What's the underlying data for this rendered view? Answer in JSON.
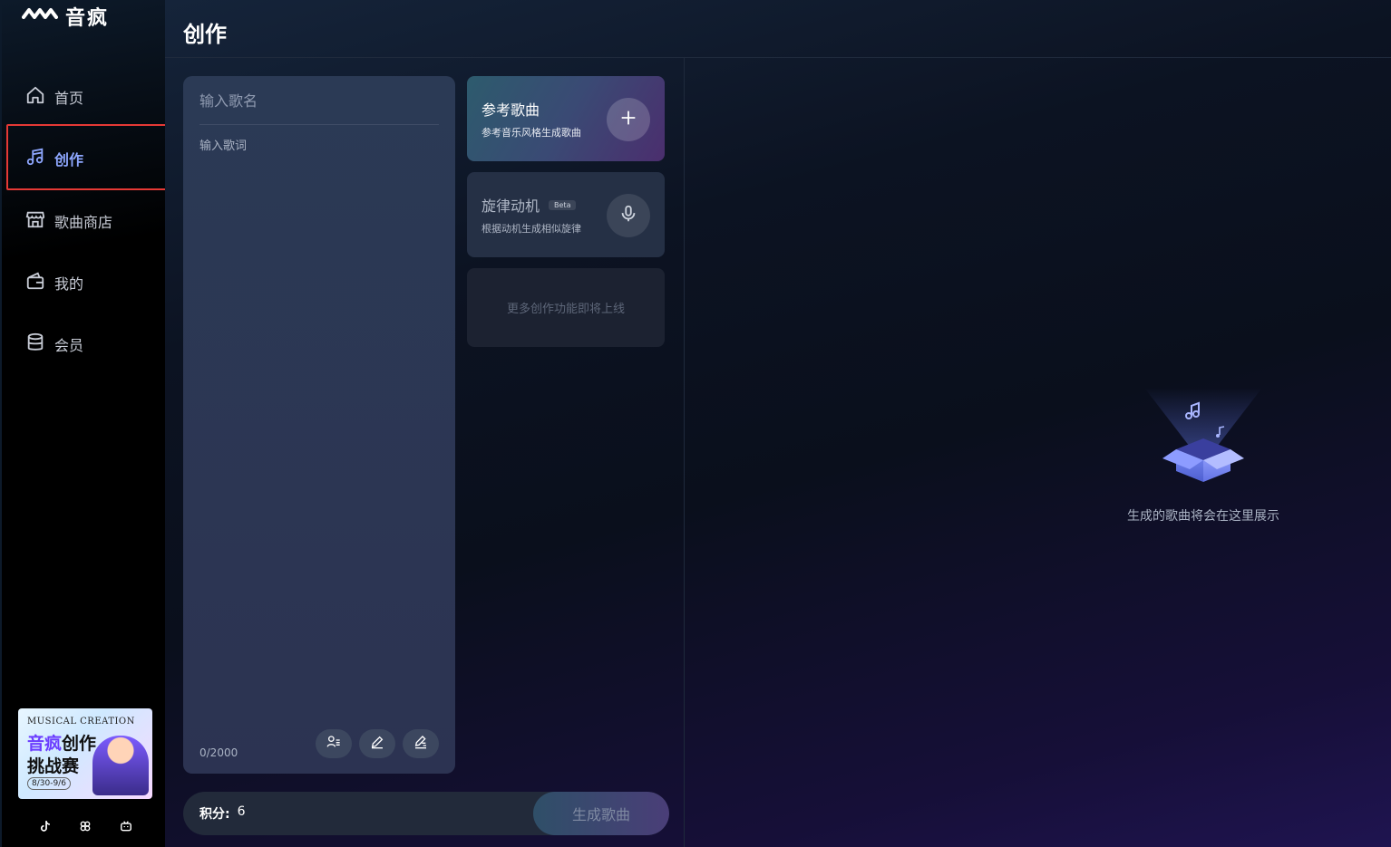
{
  "app": {
    "name": "音疯"
  },
  "sidebar": {
    "items": [
      {
        "label": "首页",
        "icon": "home-icon",
        "active": false
      },
      {
        "label": "创作",
        "icon": "music-note-icon",
        "active": true
      },
      {
        "label": "歌曲商店",
        "icon": "store-icon",
        "active": false
      },
      {
        "label": "我的",
        "icon": "wallet-icon",
        "active": false
      },
      {
        "label": "会员",
        "icon": "database-icon",
        "active": false
      }
    ],
    "banner": {
      "en": "MUSICAL CREATION",
      "line1_a": "音疯",
      "line1_b": "创作",
      "line2": "挑战赛",
      "date": "8/30-9/6"
    },
    "social": [
      "tiktok-icon",
      "community-icon",
      "bilibili-icon"
    ]
  },
  "page": {
    "title": "创作"
  },
  "editor": {
    "song_name_placeholder": "输入歌名",
    "lyrics_placeholder": "输入歌词",
    "counter": "0/2000",
    "tools": [
      "lyrics-template-icon",
      "pen-icon",
      "ai-write-icon"
    ]
  },
  "features": {
    "reference": {
      "title": "参考歌曲",
      "subtitle": "参考音乐风格生成歌曲"
    },
    "melody": {
      "title": "旋律动机",
      "badge": "Beta",
      "subtitle": "根据动机生成相似旋律"
    },
    "more": {
      "text": "更多创作功能即将上线"
    }
  },
  "bottom": {
    "credits_label": "积分:",
    "credits_value": "6",
    "generate_label": "生成歌曲"
  },
  "empty_state": {
    "text": "生成的歌曲将会在这里展示"
  },
  "colors": {
    "accent": "#8ea7ff",
    "highlight_outline": "#e53935",
    "banner_purple": "#6b3cff"
  }
}
